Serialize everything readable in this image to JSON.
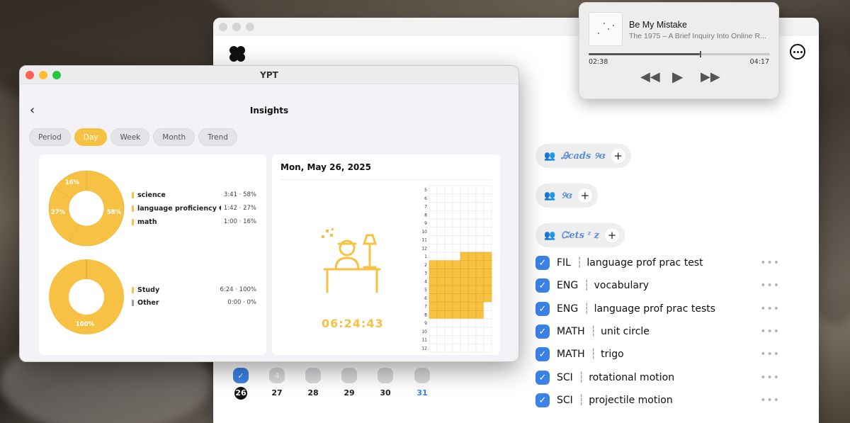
{
  "player": {
    "song_title": "Be My Mistake",
    "artist_album": "The 1975 – A Brief Inquiry Into Online R...",
    "elapsed": "02:38",
    "total": "04:17",
    "progress": 0.615
  },
  "main_window": {
    "groups": [
      {
        "name": "Ꭿcads ୨ɞ"
      },
      {
        "name": "୨ɞ"
      },
      {
        "name": "Ꮸets ᶻ z"
      }
    ],
    "tasks": [
      {
        "subject": "FIL",
        "title": "language prof prac test"
      },
      {
        "subject": "ENG",
        "title": "vocabulary"
      },
      {
        "subject": "ENG",
        "title": "language prof prac tests"
      },
      {
        "subject": "MATH",
        "title": "unit circle"
      },
      {
        "subject": "MATH",
        "title": "trigo"
      },
      {
        "subject": "SCI",
        "title": "rotational motion"
      },
      {
        "subject": "SCI",
        "title": "projectile motion"
      }
    ],
    "days": [
      {
        "num": "26",
        "badge": "",
        "done": true,
        "today": true
      },
      {
        "num": "27",
        "badge": "4",
        "done": false,
        "today": false
      },
      {
        "num": "28",
        "badge": "",
        "done": false,
        "today": false
      },
      {
        "num": "29",
        "badge": "",
        "done": false,
        "today": false
      },
      {
        "num": "30",
        "badge": "",
        "done": false,
        "today": false
      },
      {
        "num": "31",
        "badge": "",
        "done": false,
        "today": false,
        "blue": true
      }
    ]
  },
  "ypt": {
    "window_title": "YPT",
    "page_title": "Insights",
    "tabs": [
      "Period",
      "Day",
      "Week",
      "Month",
      "Trend"
    ],
    "active_tab": "Day",
    "accent": "#f7c244",
    "subjects_chart": {
      "slices": [
        {
          "label": "science",
          "value": "3:41 · 58%",
          "pct": 58,
          "pct_label": "58%"
        },
        {
          "label": "language proficiency €",
          "value": "1:42 · 27%",
          "pct": 27,
          "pct_label": "27%"
        },
        {
          "label": "math",
          "value": "1:00 · 16%",
          "pct": 16,
          "pct_label": "16%"
        }
      ]
    },
    "type_chart": {
      "slices": [
        {
          "label": "Study",
          "value": "6:24 · 100%",
          "pct": 100,
          "pct_label": "100%",
          "color": "#f7c244"
        },
        {
          "label": "Other",
          "value": "0:00 · 0%",
          "pct": 0,
          "pct_label": "",
          "color": "#9a9a9a"
        }
      ]
    },
    "date_heading": "Mon, May 26, 2025",
    "timer": "06:24:43",
    "hour_labels": [
      "5",
      "6",
      "7",
      "8",
      "9",
      "10",
      "11",
      "12",
      "1",
      "2",
      "3",
      "4",
      "5",
      "6",
      "7",
      "8",
      "9",
      "10",
      "11",
      "12"
    ],
    "filled_cells": [
      [
        8,
        4
      ],
      [
        8,
        5
      ],
      [
        8,
        6
      ],
      [
        8,
        7
      ],
      [
        9,
        0
      ],
      [
        9,
        1
      ],
      [
        9,
        2
      ],
      [
        9,
        3
      ],
      [
        9,
        4
      ],
      [
        9,
        5
      ],
      [
        9,
        6
      ],
      [
        9,
        7
      ],
      [
        10,
        0
      ],
      [
        10,
        1
      ],
      [
        10,
        2
      ],
      [
        10,
        3
      ],
      [
        10,
        4
      ],
      [
        10,
        5
      ],
      [
        10,
        6
      ],
      [
        10,
        7
      ],
      [
        11,
        0
      ],
      [
        11,
        1
      ],
      [
        11,
        2
      ],
      [
        11,
        3
      ],
      [
        11,
        4
      ],
      [
        11,
        5
      ],
      [
        11,
        6
      ],
      [
        11,
        7
      ],
      [
        12,
        0
      ],
      [
        12,
        1
      ],
      [
        12,
        2
      ],
      [
        12,
        3
      ],
      [
        12,
        4
      ],
      [
        12,
        5
      ],
      [
        12,
        6
      ],
      [
        12,
        7
      ],
      [
        13,
        0
      ],
      [
        13,
        1
      ],
      [
        13,
        2
      ],
      [
        13,
        3
      ],
      [
        13,
        4
      ],
      [
        13,
        5
      ],
      [
        13,
        6
      ],
      [
        13,
        7
      ],
      [
        14,
        0
      ],
      [
        14,
        1
      ],
      [
        14,
        2
      ],
      [
        14,
        3
      ],
      [
        14,
        4
      ],
      [
        14,
        5
      ],
      [
        14,
        6
      ],
      [
        15,
        0
      ],
      [
        15,
        1
      ],
      [
        15,
        2
      ],
      [
        15,
        3
      ],
      [
        15,
        4
      ],
      [
        15,
        5
      ],
      [
        15,
        6
      ]
    ]
  }
}
